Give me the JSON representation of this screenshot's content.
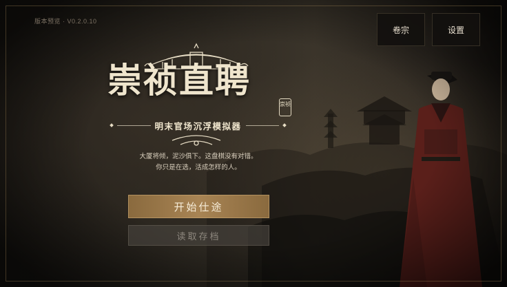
{
  "version_label": "版本预览 · V0.2.0.10",
  "top_buttons": {
    "archive_label": "卷宗",
    "settings_label": "设置"
  },
  "logo": {
    "title": "崇祯直聘",
    "seal_text": "崇祯",
    "subtitle": "明末官场沉浮模拟器"
  },
  "tagline": {
    "line1": "大厦将倾，泥沙俱下。这盘棋没有对错。",
    "line2": "你只是在选，活成怎样的人。"
  },
  "menu": {
    "start_label": "开始仕途",
    "load_label": "读取存档",
    "load_enabled": false
  },
  "colors": {
    "accent_gold": "#a88454",
    "title_cream": "#efe5cd",
    "background_dark": "#1c1915"
  }
}
